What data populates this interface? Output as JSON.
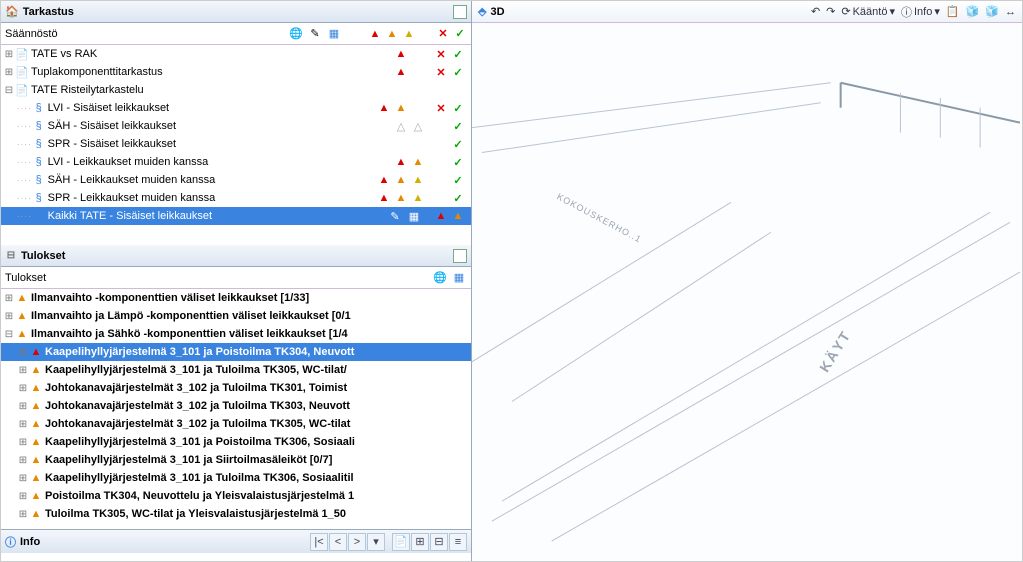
{
  "tarkastus": {
    "title": "Tarkastus",
    "subheader": "Säännöstö",
    "rows": [
      {
        "label": "TATE vs RAK",
        "level": 0,
        "tw": "col",
        "icons": [
          "warn-red"
        ],
        "tail": [
          "x-red",
          "chk-grn"
        ]
      },
      {
        "label": "Tuplakomponenttitarkastus",
        "level": 0,
        "tw": "col",
        "icons": [
          "warn-red"
        ],
        "tail": [
          "x-red",
          "chk-grn"
        ]
      },
      {
        "label": "TATE Risteilytarkastelu",
        "level": 0,
        "tw": "exp",
        "icons": [],
        "tail": []
      },
      {
        "label": "LVI - Sisäiset leikkaukset",
        "level": 1,
        "tw": "leaf",
        "sect": true,
        "icons": [
          "warn-red",
          "warn-org"
        ],
        "tail": [
          "x-red",
          "chk-grn"
        ]
      },
      {
        "label": "SÄH - Sisäiset leikkaukset",
        "level": 1,
        "tw": "leaf",
        "sect": true,
        "icons": [
          "warn-gray",
          "warn-gray"
        ],
        "tail": [
          "chk-grn"
        ]
      },
      {
        "label": "SPR - Sisäiset leikkaukset",
        "level": 1,
        "tw": "leaf",
        "sect": true,
        "icons": [],
        "tail": [
          "chk-grn"
        ]
      },
      {
        "label": "LVI - Leikkaukset muiden kanssa",
        "level": 1,
        "tw": "leaf",
        "sect": true,
        "icons": [
          "warn-red",
          "warn-org"
        ],
        "tail": [
          "chk-grn"
        ]
      },
      {
        "label": "SÄH - Leikkaukset muiden kanssa",
        "level": 1,
        "tw": "leaf",
        "sect": true,
        "icons": [
          "warn-red",
          "warn-org",
          "warn-yel"
        ],
        "tail": [
          "chk-grn"
        ]
      },
      {
        "label": "SPR - Leikkaukset muiden kanssa",
        "level": 1,
        "tw": "leaf",
        "sect": true,
        "icons": [
          "warn-red",
          "warn-org",
          "warn-yel"
        ],
        "tail": [
          "chk-grn"
        ]
      },
      {
        "label": "Kaikki TATE - Sisäiset leikkaukset",
        "level": 1,
        "tw": "leaf",
        "sect": true,
        "icons": [
          "warn-red",
          "warn-org"
        ],
        "tail": [],
        "selected": true,
        "midTools": true
      }
    ]
  },
  "tulokset": {
    "title": "Tulokset",
    "subheader": "Tulokset",
    "rows": [
      {
        "label": "Ilmanvaihto -komponenttien väliset leikkaukset [1/33]",
        "level": 0,
        "tw": "col",
        "ico": "warn-org",
        "bold": true
      },
      {
        "label": "Ilmanvaihto ja Lämpö -komponenttien väliset leikkaukset [0/1",
        "level": 0,
        "tw": "col",
        "ico": "warn-org",
        "bold": true
      },
      {
        "label": "Ilmanvaihto ja Sähkö -komponenttien väliset leikkaukset [1/4",
        "level": 0,
        "tw": "exp",
        "ico": "warn-org",
        "bold": true
      },
      {
        "label": "Kaapelihyllyjärjestelmä 3_101 ja Poistoilma TK304, Neuvott",
        "level": 1,
        "tw": "col",
        "ico": "warn-red",
        "bold": true,
        "selected": true
      },
      {
        "label": "Kaapelihyllyjärjestelmä 3_101 ja Tuloilma TK305, WC-tilat/",
        "level": 1,
        "tw": "col",
        "ico": "warn-org",
        "bold": true
      },
      {
        "label": "Johtokanavajärjestelmät 3_102 ja Tuloilma TK301, Toimist",
        "level": 1,
        "tw": "col",
        "ico": "warn-org",
        "bold": true
      },
      {
        "label": "Johtokanavajärjestelmät 3_102 ja Tuloilma TK303, Neuvott",
        "level": 1,
        "tw": "col",
        "ico": "warn-org",
        "bold": true
      },
      {
        "label": "Johtokanavajärjestelmät 3_102 ja Tuloilma TK305, WC-tilat",
        "level": 1,
        "tw": "col",
        "ico": "warn-org",
        "bold": true
      },
      {
        "label": "Kaapelihyllyjärjestelmä 3_101 ja Poistoilma TK306, Sosiaali",
        "level": 1,
        "tw": "col",
        "ico": "warn-org",
        "bold": true
      },
      {
        "label": "Kaapelihyllyjärjestelmä 3_101 ja Siirtoilmasäleiköt [0/7]",
        "level": 1,
        "tw": "col",
        "ico": "warn-org",
        "bold": true
      },
      {
        "label": "Kaapelihyllyjärjestelmä 3_101 ja Tuloilma TK306, Sosiaalitil",
        "level": 1,
        "tw": "col",
        "ico": "warn-org",
        "bold": true
      },
      {
        "label": "Poistoilma TK304, Neuvottelu ja Yleisvalaistusjärjestelmä 1",
        "level": 1,
        "tw": "col",
        "ico": "warn-org",
        "bold": true
      },
      {
        "label": "Tuloilma TK305, WC-tilat ja Yleisvalaistusjärjestelmä 1_50",
        "level": 1,
        "tw": "col",
        "ico": "warn-org",
        "bold": true
      }
    ]
  },
  "info": {
    "title": "Info"
  },
  "right": {
    "title": "3D",
    "btn_rotate": "Kääntö",
    "btn_info": "Info",
    "floor_label": "KÄYT",
    "floor_label2": "KOKOUSKERHO..1"
  }
}
